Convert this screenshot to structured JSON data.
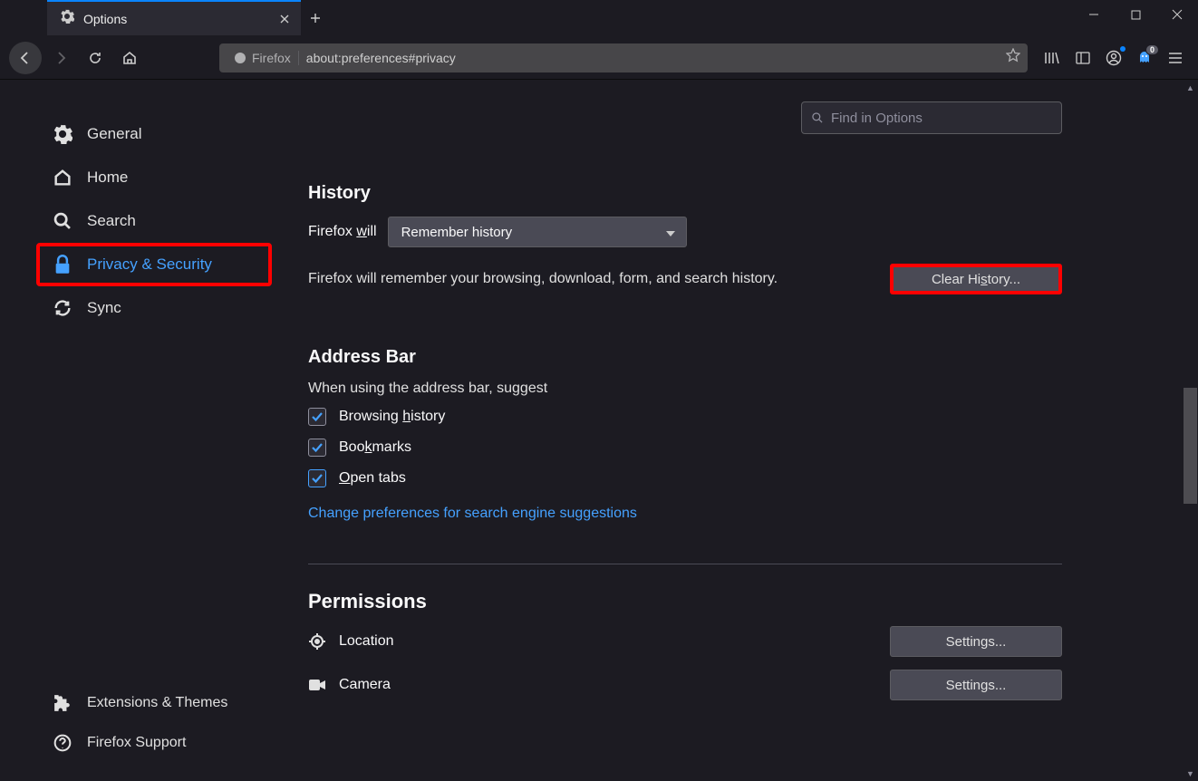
{
  "tab": {
    "title": "Options"
  },
  "url": {
    "identity": "Firefox",
    "address": "about:preferences#privacy"
  },
  "search": {
    "placeholder": "Find in Options"
  },
  "sidebar": {
    "items": [
      {
        "label": "General"
      },
      {
        "label": "Home"
      },
      {
        "label": "Search"
      },
      {
        "label": "Privacy & Security"
      },
      {
        "label": "Sync"
      }
    ],
    "bottom": [
      {
        "label": "Extensions & Themes"
      },
      {
        "label": "Firefox Support"
      }
    ]
  },
  "history": {
    "heading": "History",
    "will_prefix": "Firefox ",
    "will_u": "w",
    "will_suffix": "ill",
    "dropdown": "Remember history",
    "desc": "Firefox will remember your browsing, download, form, and search history.",
    "clear_btn_pre": "Clear Hi",
    "clear_btn_u": "s",
    "clear_btn_post": "tory..."
  },
  "addressbar": {
    "heading": "Address Bar",
    "sub": "When using the address bar, suggest",
    "items": [
      {
        "pre": "Browsing ",
        "u": "h",
        "post": "istory"
      },
      {
        "pre": "Boo",
        "u": "k",
        "post": "marks"
      },
      {
        "pre": "",
        "u": "O",
        "post": "pen tabs"
      }
    ],
    "link": "Change preferences for search engine suggestions"
  },
  "permissions": {
    "heading": "Permissions",
    "rows": [
      {
        "label": "Location",
        "btn": "Settings..."
      },
      {
        "label": "Camera",
        "btn": "Settings..."
      }
    ]
  },
  "ghostery_badge": "0"
}
